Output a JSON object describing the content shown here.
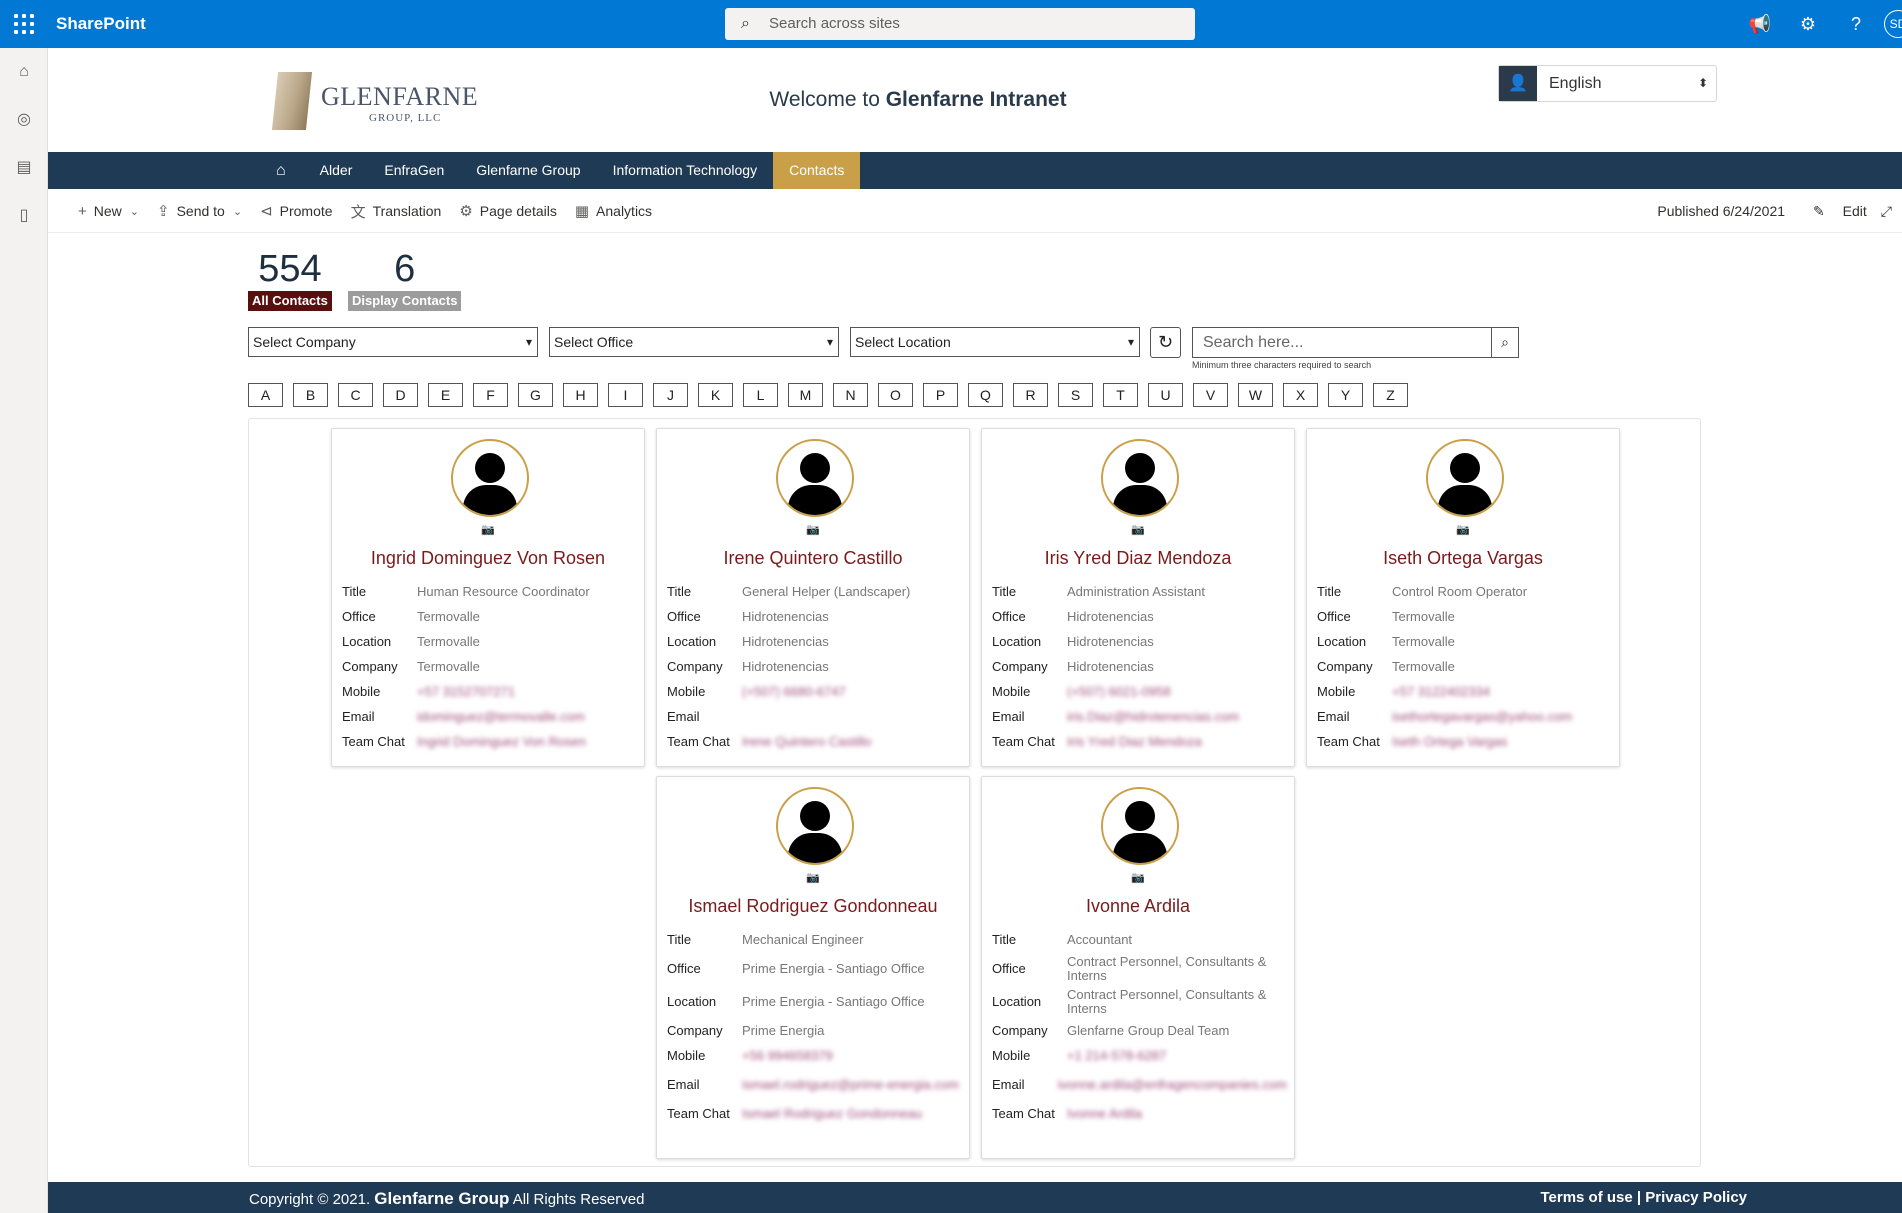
{
  "suitebar": {
    "brand": "SharePoint",
    "search_placeholder": "Search across sites",
    "avatar_initials": "SD"
  },
  "header": {
    "logo_word": "GLENFARNE",
    "logo_sub": "GROUP, LLC",
    "welcome_prefix": "Welcome to ",
    "welcome_site": "Glenfarne Intranet",
    "language": "English"
  },
  "nav": {
    "items": [
      "Alder",
      "EnfraGen",
      "Glenfarne Group",
      "Information Technology",
      "Contacts"
    ],
    "active": "Contacts"
  },
  "cmdbar": {
    "new": "New",
    "send_to": "Send to",
    "promote": "Promote",
    "translation": "Translation",
    "page_details": "Page details",
    "analytics": "Analytics",
    "published": "Published 6/24/2021",
    "edit": "Edit"
  },
  "stats": {
    "all_count": "554",
    "all_label": "All Contacts",
    "all_color": "#5a0f0f",
    "display_count": "6",
    "display_label": "Display Contacts",
    "display_color": "#9c9c9c"
  },
  "filters": {
    "company": "Select Company",
    "office": "Select Office",
    "location": "Select Location",
    "search_placeholder": "Search here...",
    "hint": "Minimum three characters required to search"
  },
  "letters": [
    "A",
    "B",
    "C",
    "D",
    "E",
    "F",
    "G",
    "H",
    "I",
    "J",
    "K",
    "L",
    "M",
    "N",
    "O",
    "P",
    "Q",
    "R",
    "S",
    "T",
    "U",
    "V",
    "W",
    "X",
    "Y",
    "Z"
  ],
  "field_labels": {
    "title": "Title",
    "office": "Office",
    "location": "Location",
    "company": "Company",
    "mobile": "Mobile",
    "email": "Email",
    "team_chat": "Team Chat"
  },
  "contacts": [
    {
      "name": "Ingrid Dominguez Von Rosen",
      "title": "Human Resource Coordinator",
      "office": "Termovalle",
      "location": "Termovalle",
      "company": "Termovalle",
      "mobile": "+57 3152707271",
      "email": "idominguez@termovalle.com",
      "team_chat": "Ingrid Dominguez Von Rosen"
    },
    {
      "name": "Irene Quintero Castillo",
      "title": "General Helper (Landscaper)",
      "office": "Hidrotenencias",
      "location": "Hidrotenencias",
      "company": "Hidrotenencias",
      "mobile": "(+507) 6680-6747",
      "email": "",
      "team_chat": "Irene Quintero Castillo"
    },
    {
      "name": "Iris Yred Diaz Mendoza",
      "title": "Administration Assistant",
      "office": "Hidrotenencias",
      "location": "Hidrotenencias",
      "company": "Hidrotenencias",
      "mobile": "(+507) 6021-0958",
      "email": "iris.Diaz@hidrotenencias.com",
      "team_chat": "Iris Yred Diaz Mendoza"
    },
    {
      "name": "Iseth Ortega Vargas",
      "title": "Control Room Operator",
      "office": "Termovalle",
      "location": "Termovalle",
      "company": "Termovalle",
      "mobile": "+57 3122402334",
      "email": "isethortegavargas@yahoo.com",
      "team_chat": "Iseth Ortega Vargas"
    },
    {
      "name": "Ismael Rodriguez Gondonneau",
      "title": "Mechanical Engineer",
      "office": "Prime Energia - Santiago Office",
      "location": "Prime Energia - Santiago Office",
      "company": "Prime Energia",
      "mobile": "+56 994658379",
      "email": "ismael.rodriguez@prime-energia.com",
      "team_chat": "Ismael Rodriguez Gondonneau"
    },
    {
      "name": "Ivonne Ardila",
      "title": "Accountant",
      "office": "Contract Personnel, Consultants & Interns",
      "location": "Contract Personnel, Consultants & Interns",
      "company": "Glenfarne Group Deal Team",
      "mobile": "+1 214-578-6287",
      "email": "ivonne.ardila@enfragencompanies.com",
      "team_chat": "Ivonne Ardila"
    }
  ],
  "footer": {
    "copy_prefix": "Copyright © 2021. ",
    "copy_brand": "Glenfarne Group",
    "copy_suffix": " All Rights Reserved",
    "terms": "Terms of use",
    "separator": " | ",
    "privacy": "Privacy Policy"
  },
  "colors": {
    "suitebar": "#0078d4",
    "nav": "#1f3a55",
    "nav_active": "#c9a047",
    "contact_name": "#7a1b1b"
  }
}
